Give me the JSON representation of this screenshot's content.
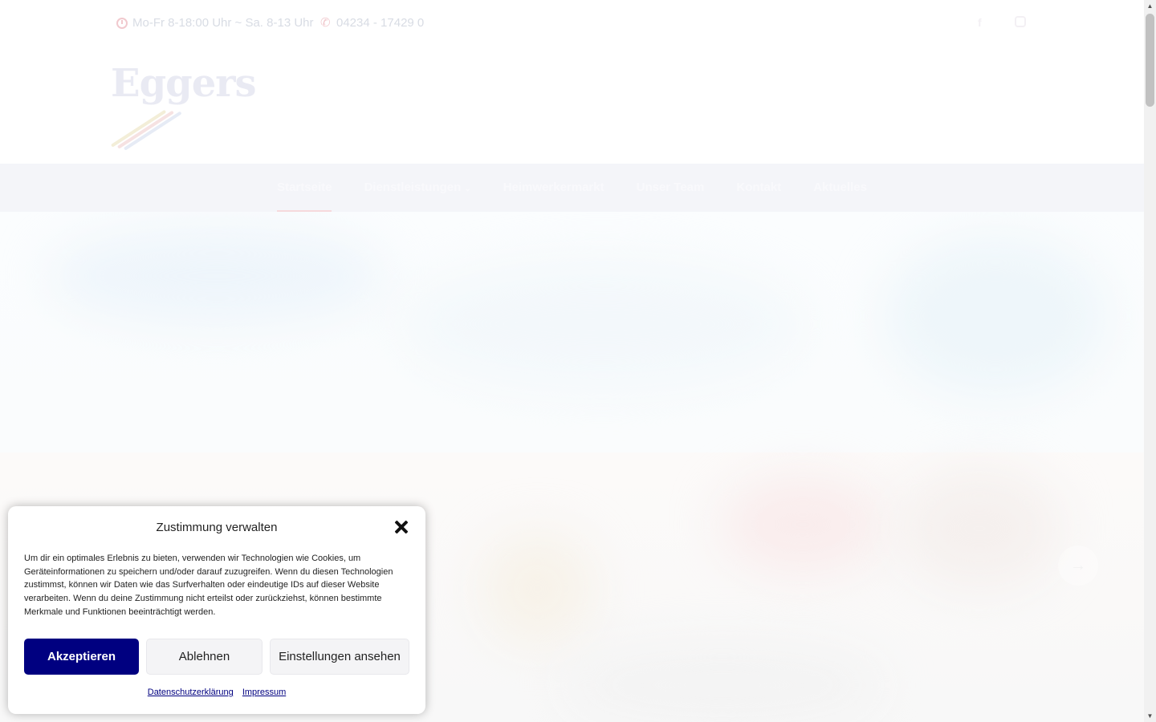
{
  "topbar": {
    "hours": "Mo-Fr 8-18:00 Uhr ~ Sa. 8-13 Uhr",
    "phone": "04234 - 17429 0",
    "icons": [
      "clock-icon",
      "phone-icon",
      "facebook-icon",
      "instagram-icon"
    ]
  },
  "logo": {
    "text": "Eggers"
  },
  "nav": {
    "items": [
      {
        "label": "Startseite",
        "active": true
      },
      {
        "label": "Dienstleistungen",
        "has_dropdown": true
      },
      {
        "label": "Heimwerkermarkt"
      },
      {
        "label": "Unser Team"
      },
      {
        "label": "Kontakt"
      },
      {
        "label": "Aktuelles"
      }
    ]
  },
  "hero": {
    "next_arrow": "→"
  },
  "consent": {
    "title": "Zustimmung verwalten",
    "text": "Um dir ein optimales Erlebnis zu bieten, verwenden wir Technologien wie Cookies, um Geräteinformationen zu speichern und/oder darauf zuzugreifen. Wenn du diesen Technologien zustimmst, können wir Daten wie das Surfverhalten oder eindeutige IDs auf dieser Website verarbeiten. Wenn du deine Zustimmung nicht erteilst oder zurückziehst, können bestimmte Merkmale und Funktionen beeinträchtigt werden.",
    "accept_label": "Akzeptieren",
    "deny_label": "Ablehnen",
    "settings_label": "Einstellungen ansehen",
    "privacy_link": "Datenschutzerklärung",
    "imprint_link": "Impressum"
  },
  "colors": {
    "accent": "#000080",
    "nav_bg": "#f4f5f9"
  }
}
